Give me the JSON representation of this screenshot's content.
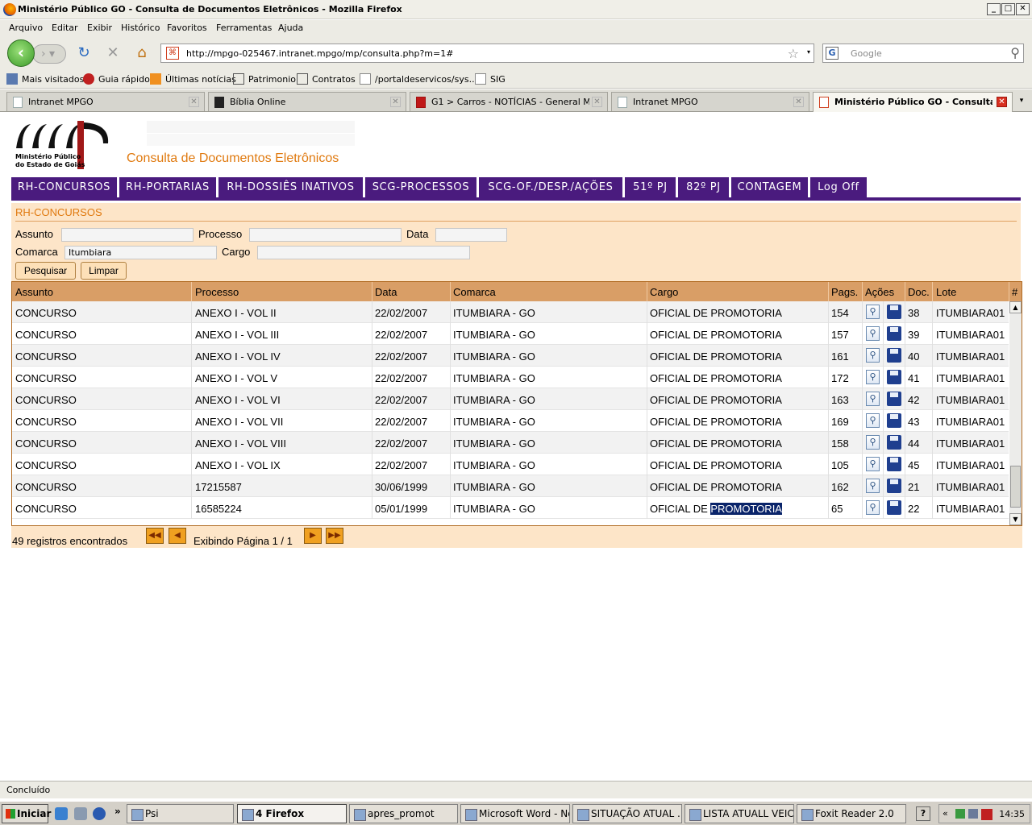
{
  "window": {
    "title": "Ministério Público GO - Consulta de Documentos Eletrônicos - Mozilla Firefox"
  },
  "menu": [
    "Arquivo",
    "Editar",
    "Exibir",
    "Histórico",
    "Favoritos",
    "Ferramentas",
    "Ajuda"
  ],
  "address": {
    "url": "http://mpgo-025467.intranet.mpgo/mp/consulta.php?m=1#"
  },
  "search": {
    "placeholder": "Google"
  },
  "bookmarks": [
    "Mais visitados",
    "Guia rápido",
    "Últimas notícias",
    "Patrimonio",
    "Contratos",
    "/portaldeservicos/sys...",
    "SIG"
  ],
  "tabs": [
    "Intranet MPGO",
    "Bíblia Online",
    "G1 > Carros - NOTÍCIAS - General Mot...",
    "Intranet MPGO",
    "Ministério Público GO - Consulta ..."
  ],
  "page": {
    "logo_line1": "Ministério Público",
    "logo_line2": "do Estado de Goiás",
    "title": "Consulta de Documentos Eletrônicos",
    "nav": [
      "RH-CONCURSOS",
      "RH-PORTARIAS",
      "RH-DOSSIÊS INATIVOS",
      "SCG-PROCESSOS",
      "SCG-OF./DESP./AÇÕES",
      "51º PJ",
      "82º PJ",
      "CONTAGEM",
      "Log Off"
    ],
    "section": "RH-CONCURSOS",
    "form": {
      "assunto_label": "Assunto",
      "processo_label": "Processo",
      "data_label": "Data",
      "comarca_label": "Comarca",
      "comarca_value": "Itumbiara",
      "cargo_label": "Cargo",
      "search_btn": "Pesquisar",
      "clear_btn": "Limpar"
    },
    "table": {
      "headers": [
        "Assunto",
        "Processo",
        "Data",
        "Comarca",
        "Cargo",
        "Pags.",
        "Ações",
        "Doc.",
        "Lote",
        "#"
      ],
      "rows": [
        [
          "CONCURSO",
          "ANEXO I - VOL II",
          "22/02/2007",
          "ITUMBIARA - GO",
          "OFICIAL DE PROMOTORIA",
          "154",
          "38",
          "ITUMBIARA01"
        ],
        [
          "CONCURSO",
          "ANEXO I - VOL III",
          "22/02/2007",
          "ITUMBIARA - GO",
          "OFICIAL DE PROMOTORIA",
          "157",
          "39",
          "ITUMBIARA01"
        ],
        [
          "CONCURSO",
          "ANEXO I - VOL IV",
          "22/02/2007",
          "ITUMBIARA - GO",
          "OFICIAL DE PROMOTORIA",
          "161",
          "40",
          "ITUMBIARA01"
        ],
        [
          "CONCURSO",
          "ANEXO I - VOL V",
          "22/02/2007",
          "ITUMBIARA - GO",
          "OFICIAL DE PROMOTORIA",
          "172",
          "41",
          "ITUMBIARA01"
        ],
        [
          "CONCURSO",
          "ANEXO I - VOL VI",
          "22/02/2007",
          "ITUMBIARA - GO",
          "OFICIAL DE PROMOTORIA",
          "163",
          "42",
          "ITUMBIARA01"
        ],
        [
          "CONCURSO",
          "ANEXO I - VOL VII",
          "22/02/2007",
          "ITUMBIARA - GO",
          "OFICIAL DE PROMOTORIA",
          "169",
          "43",
          "ITUMBIARA01"
        ],
        [
          "CONCURSO",
          "ANEXO I - VOL VIII",
          "22/02/2007",
          "ITUMBIARA - GO",
          "OFICIAL DE PROMOTORIA",
          "158",
          "44",
          "ITUMBIARA01"
        ],
        [
          "CONCURSO",
          "ANEXO I - VOL IX",
          "22/02/2007",
          "ITUMBIARA - GO",
          "OFICIAL DE PROMOTORIA",
          "105",
          "45",
          "ITUMBIARA01"
        ],
        [
          "CONCURSO",
          "17215587",
          "30/06/1999",
          "ITUMBIARA - GO",
          "OFICIAL DE PROMOTORIA",
          "162",
          "21",
          "ITUMBIARA01"
        ],
        [
          "CONCURSO",
          "16585224",
          "05/01/1999",
          "ITUMBIARA - GO",
          "OFICIAL DE PROMOTORIA",
          "65",
          "22",
          "ITUMBIARA01"
        ]
      ],
      "selected_text_prefix": "OFICIAL DE ",
      "selected_text": "PROMOTORIA"
    },
    "pager": {
      "count": "49 registros encontrados",
      "page": "Exibindo Página 1 / 1"
    }
  },
  "status": "Concluído",
  "taskbar": {
    "start": "Iniciar",
    "items": [
      "Psi",
      "4 Firefox",
      "apres_promot",
      "Microsoft Word - No...",
      "SITUAÇÃO ATUAL ...",
      "LISTA ATUALL VEIC...",
      "Foxit Reader 2.0"
    ],
    "clock": "14:35"
  }
}
